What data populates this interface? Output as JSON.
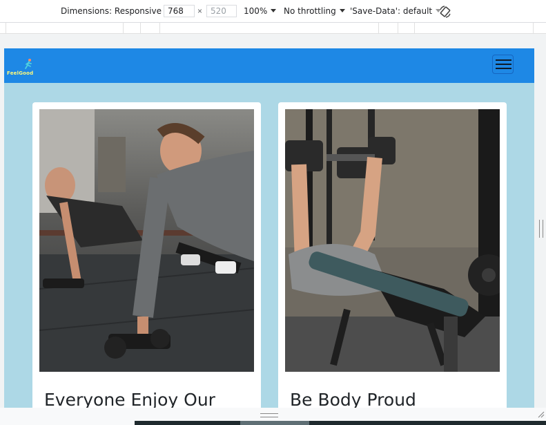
{
  "devtools": {
    "dimensions_label": "Dimensions: Responsive",
    "width_value": "768",
    "height_value": "520",
    "times": "×",
    "zoom": "100%",
    "throttling": "No throttling",
    "save_data": "'Save-Data': default",
    "rotate_icon": "rotate-icon"
  },
  "site": {
    "brand": "FeelGood",
    "nav_toggle_icon": "hamburger-menu-icon",
    "colors": {
      "navbar": "#1e88e5",
      "background": "#add8e6"
    },
    "cards": [
      {
        "title": "Everyone Enjoy Our",
        "image": "man-doing-dumbbell-push-up-rows-photo"
      },
      {
        "title": "Be Body Proud",
        "image": "man-doing-dumbbell-bench-press-photo"
      }
    ]
  }
}
